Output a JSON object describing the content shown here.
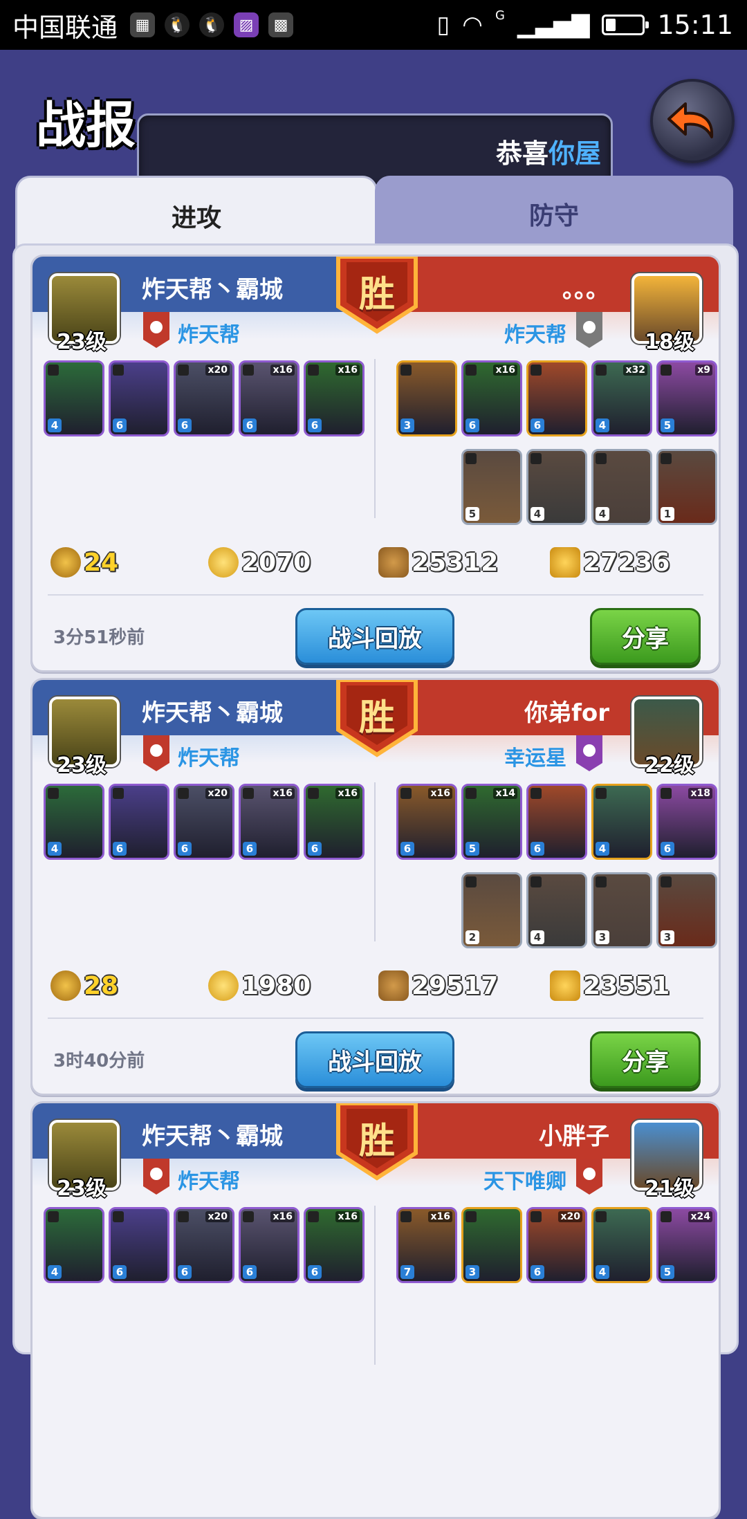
{
  "status_bar": {
    "carrier": "中国联通",
    "time": "15:11",
    "network": "G",
    "icons": [
      "app-icon",
      "qq-icon",
      "qq-icon",
      "gallery-icon",
      "app-icon",
      "vibrate-icon",
      "wifi-icon",
      "signal-icon",
      "battery-icon"
    ]
  },
  "header": {
    "title": "战报",
    "marquee_text": "恭喜",
    "marquee_highlight": "你屋",
    "back_icon": "back-arrow-icon"
  },
  "tabs": [
    {
      "label": "进攻",
      "active": true
    },
    {
      "label": "防守",
      "active": false
    }
  ],
  "reports": [
    {
      "result": "胜",
      "left": {
        "name": "炸天帮丶霸城",
        "level": "23级",
        "guild": "炸天帮"
      },
      "right": {
        "name": "。。。",
        "level": "18级",
        "guild": "炸天帮"
      },
      "left_units": [
        {
          "lvl": "4",
          "cnt": ""
        },
        {
          "lvl": "6",
          "cnt": ""
        },
        {
          "lvl": "6",
          "cnt": "x20"
        },
        {
          "lvl": "6",
          "cnt": "x16"
        },
        {
          "lvl": "6",
          "cnt": "x16"
        }
      ],
      "right_units": [
        {
          "lvl": "3",
          "cnt": ""
        },
        {
          "lvl": "6",
          "cnt": "x16"
        },
        {
          "lvl": "6",
          "cnt": ""
        },
        {
          "lvl": "4",
          "cnt": "x32"
        },
        {
          "lvl": "5",
          "cnt": "x9"
        }
      ],
      "right_buildings": [
        {
          "lvl": "5"
        },
        {
          "lvl": "4"
        },
        {
          "lvl": "4"
        },
        {
          "lvl": "1"
        }
      ],
      "resources": {
        "medal": "24",
        "gold": "2070",
        "wood": "25312",
        "food": "27236"
      },
      "time_ago": "3分51秒前",
      "replay_label": "战斗回放",
      "share_label": "分享"
    },
    {
      "result": "胜",
      "left": {
        "name": "炸天帮丶霸城",
        "level": "23级",
        "guild": "炸天帮"
      },
      "right": {
        "name": "你弟for",
        "level": "22级",
        "guild": "幸运星"
      },
      "left_units": [
        {
          "lvl": "4",
          "cnt": ""
        },
        {
          "lvl": "6",
          "cnt": ""
        },
        {
          "lvl": "6",
          "cnt": "x20"
        },
        {
          "lvl": "6",
          "cnt": "x16"
        },
        {
          "lvl": "6",
          "cnt": "x16"
        }
      ],
      "right_units": [
        {
          "lvl": "6",
          "cnt": "x16"
        },
        {
          "lvl": "5",
          "cnt": "x14"
        },
        {
          "lvl": "6",
          "cnt": ""
        },
        {
          "lvl": "4",
          "cnt": ""
        },
        {
          "lvl": "6",
          "cnt": "x18"
        }
      ],
      "right_buildings": [
        {
          "lvl": "2"
        },
        {
          "lvl": "4"
        },
        {
          "lvl": "3"
        },
        {
          "lvl": "3"
        }
      ],
      "resources": {
        "medal": "28",
        "gold": "1980",
        "wood": "29517",
        "food": "23551"
      },
      "time_ago": "3时40分前",
      "replay_label": "战斗回放",
      "share_label": "分享"
    },
    {
      "result": "胜",
      "left": {
        "name": "炸天帮丶霸城",
        "level": "23级",
        "guild": "炸天帮"
      },
      "right": {
        "name": "小胖子",
        "level": "21级",
        "guild": "天下唯卿"
      },
      "left_units": [
        {
          "lvl": "4",
          "cnt": ""
        },
        {
          "lvl": "6",
          "cnt": ""
        },
        {
          "lvl": "6",
          "cnt": "x20"
        },
        {
          "lvl": "6",
          "cnt": "x16"
        },
        {
          "lvl": "6",
          "cnt": "x16"
        }
      ],
      "right_units": [
        {
          "lvl": "7",
          "cnt": "x16"
        },
        {
          "lvl": "3",
          "cnt": ""
        },
        {
          "lvl": "6",
          "cnt": "x20"
        },
        {
          "lvl": "4",
          "cnt": ""
        },
        {
          "lvl": "5",
          "cnt": "x24"
        }
      ],
      "right_buildings": [],
      "resources": {
        "medal": "",
        "gold": "",
        "wood": "",
        "food": ""
      },
      "time_ago": "",
      "replay_label": "",
      "share_label": ""
    }
  ],
  "colors": {
    "background": "#3f3f86",
    "attacker_band": "#3b5ea6",
    "defender_band": "#c1392a",
    "guild_text": "#2b95e4",
    "replay_button": "#2a8ed9",
    "share_button": "#3c9a1e"
  }
}
